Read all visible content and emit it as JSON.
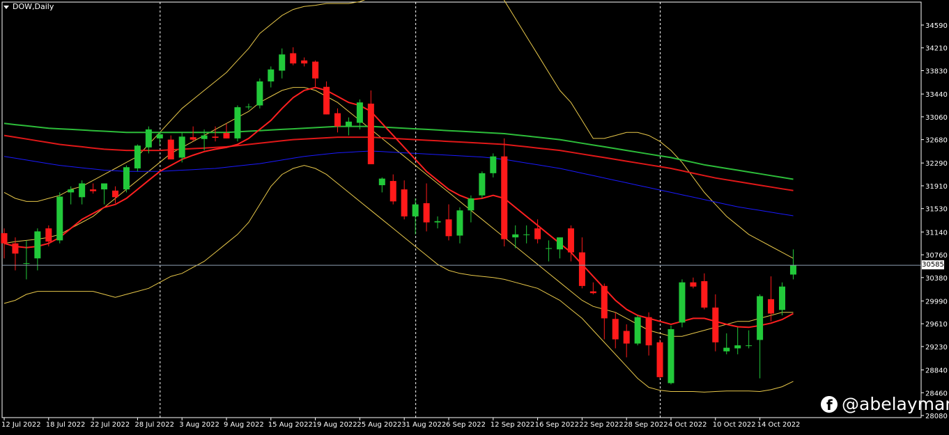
{
  "header": {
    "symbol_timeframe": "DOW,Daily"
  },
  "watermark": {
    "text": "@abelayman",
    "icon": "facebook-icon"
  },
  "current_price_label": "30585",
  "colors": {
    "background": "#000000",
    "bull": "#22c93a",
    "bear": "#ff1a1a",
    "ema_fast": "#ff2020",
    "ema_slow_red": "#e01818",
    "ema_green": "#2dbd3a",
    "ema_blue": "#1a1aff",
    "bands": "#e8c84a",
    "grid": "#ffffff",
    "axis": "#ffffff"
  },
  "chart_data": {
    "type": "candlestick",
    "title": "DOW,Daily",
    "y_ticks": [
      "34590",
      "34210",
      "33830",
      "33440",
      "33060",
      "32680",
      "32290",
      "31910",
      "31530",
      "31140",
      "30760",
      "30380",
      "29990",
      "29610",
      "29230",
      "28840",
      "28460",
      "28080"
    ],
    "y_tick_values": [
      34590,
      34210,
      33830,
      33440,
      33060,
      32680,
      32290,
      31910,
      31530,
      31140,
      30760,
      30380,
      29990,
      29610,
      29230,
      28840,
      28460,
      28080
    ],
    "x_ticks": [
      "12 Jul 2022",
      "18 Jul 2022",
      "22 Jul 2022",
      "28 Jul 2022",
      "3 Aug 2022",
      "9 Aug 2022",
      "15 Aug 2022",
      "19 Aug 2022",
      "25 Aug 2022",
      "31 Aug 2022",
      "6 Sep 2022",
      "12 Sep 2022",
      "16 Sep 2022",
      "22 Sep 2022",
      "28 Sep 2022",
      "4 Oct 2022",
      "10 Oct 2022",
      "14 Oct 2022"
    ],
    "current_price": 30585,
    "candles": [
      {
        "o": 31120,
        "h": 31200,
        "l": 30700,
        "c": 30950
      },
      {
        "o": 30950,
        "h": 31050,
        "l": 30500,
        "c": 30780
      },
      {
        "o": 30620,
        "h": 31000,
        "l": 30350,
        "c": 30620
      },
      {
        "o": 30700,
        "h": 31200,
        "l": 30500,
        "c": 31150
      },
      {
        "o": 31200,
        "h": 31250,
        "l": 30900,
        "c": 30980
      },
      {
        "o": 31000,
        "h": 31800,
        "l": 30950,
        "c": 31730
      },
      {
        "o": 31800,
        "h": 31900,
        "l": 31600,
        "c": 31850
      },
      {
        "o": 31720,
        "h": 32000,
        "l": 31600,
        "c": 31950
      },
      {
        "o": 31850,
        "h": 31950,
        "l": 31780,
        "c": 31820
      },
      {
        "o": 31850,
        "h": 31950,
        "l": 31600,
        "c": 31950
      },
      {
        "o": 31830,
        "h": 31900,
        "l": 31620,
        "c": 31720
      },
      {
        "o": 31850,
        "h": 32250,
        "l": 31800,
        "c": 32220
      },
      {
        "o": 32200,
        "h": 32600,
        "l": 32150,
        "c": 32580
      },
      {
        "o": 32550,
        "h": 32900,
        "l": 32450,
        "c": 32850
      },
      {
        "o": 32700,
        "h": 32800,
        "l": 32600,
        "c": 32770
      },
      {
        "o": 32680,
        "h": 32750,
        "l": 32350,
        "c": 32350
      },
      {
        "o": 32380,
        "h": 32800,
        "l": 32300,
        "c": 32730
      },
      {
        "o": 32720,
        "h": 32900,
        "l": 32650,
        "c": 32680
      },
      {
        "o": 32690,
        "h": 32850,
        "l": 32500,
        "c": 32750
      },
      {
        "o": 32730,
        "h": 32900,
        "l": 32650,
        "c": 32710
      },
      {
        "o": 32790,
        "h": 32950,
        "l": 32700,
        "c": 32700
      },
      {
        "o": 32700,
        "h": 33250,
        "l": 32650,
        "c": 33220
      },
      {
        "o": 33230,
        "h": 33280,
        "l": 33180,
        "c": 33230
      },
      {
        "o": 33250,
        "h": 33700,
        "l": 33200,
        "c": 33650
      },
      {
        "o": 33650,
        "h": 33900,
        "l": 33550,
        "c": 33850
      },
      {
        "o": 33830,
        "h": 34200,
        "l": 33700,
        "c": 34100
      },
      {
        "o": 34120,
        "h": 34220,
        "l": 33920,
        "c": 33950
      },
      {
        "o": 34000,
        "h": 34050,
        "l": 33900,
        "c": 33950
      },
      {
        "o": 33980,
        "h": 34000,
        "l": 33550,
        "c": 33700
      },
      {
        "o": 33560,
        "h": 33650,
        "l": 33100,
        "c": 33100
      },
      {
        "o": 33120,
        "h": 33200,
        "l": 32800,
        "c": 32900
      },
      {
        "o": 32900,
        "h": 33050,
        "l": 32750,
        "c": 32980
      },
      {
        "o": 32960,
        "h": 33350,
        "l": 32850,
        "c": 33300
      },
      {
        "o": 33280,
        "h": 33500,
        "l": 32300,
        "c": 32270
      },
      {
        "o": 31920,
        "h": 32050,
        "l": 31800,
        "c": 32030
      },
      {
        "o": 31990,
        "h": 32100,
        "l": 31600,
        "c": 31650
      },
      {
        "o": 31850,
        "h": 32000,
        "l": 31350,
        "c": 31400
      },
      {
        "o": 31400,
        "h": 31700,
        "l": 31100,
        "c": 31600
      },
      {
        "o": 31620,
        "h": 31950,
        "l": 31150,
        "c": 31300
      },
      {
        "o": 31300,
        "h": 31400,
        "l": 31200,
        "c": 31320
      },
      {
        "o": 31350,
        "h": 31600,
        "l": 31000,
        "c": 31070
      },
      {
        "o": 31080,
        "h": 31550,
        "l": 30950,
        "c": 31500
      },
      {
        "o": 31500,
        "h": 31750,
        "l": 31300,
        "c": 31700
      },
      {
        "o": 31750,
        "h": 32150,
        "l": 31700,
        "c": 32120
      },
      {
        "o": 32120,
        "h": 32450,
        "l": 32050,
        "c": 32400
      },
      {
        "o": 32400,
        "h": 32700,
        "l": 30900,
        "c": 31020
      },
      {
        "o": 31050,
        "h": 31250,
        "l": 30870,
        "c": 31100
      },
      {
        "o": 31100,
        "h": 31250,
        "l": 30950,
        "c": 31100
      },
      {
        "o": 31200,
        "h": 31350,
        "l": 30950,
        "c": 31020
      },
      {
        "o": 30870,
        "h": 31000,
        "l": 30650,
        "c": 30870
      },
      {
        "o": 30850,
        "h": 31050,
        "l": 30700,
        "c": 31050
      },
      {
        "o": 31200,
        "h": 31250,
        "l": 30650,
        "c": 30800
      },
      {
        "o": 30800,
        "h": 31050,
        "l": 30200,
        "c": 30240
      },
      {
        "o": 30150,
        "h": 30300,
        "l": 30100,
        "c": 30120
      },
      {
        "o": 30240,
        "h": 30280,
        "l": 29350,
        "c": 29700
      },
      {
        "o": 29690,
        "h": 29800,
        "l": 29200,
        "c": 29350
      },
      {
        "o": 29490,
        "h": 29600,
        "l": 29050,
        "c": 29280
      },
      {
        "o": 29280,
        "h": 29750,
        "l": 29250,
        "c": 29720
      },
      {
        "o": 29720,
        "h": 29800,
        "l": 29080,
        "c": 29250
      },
      {
        "o": 29300,
        "h": 29350,
        "l": 28700,
        "c": 28720
      },
      {
        "o": 28620,
        "h": 29580,
        "l": 28600,
        "c": 29520
      },
      {
        "o": 29630,
        "h": 30350,
        "l": 29550,
        "c": 30300
      },
      {
        "o": 30300,
        "h": 30380,
        "l": 30200,
        "c": 30230
      },
      {
        "o": 30320,
        "h": 30450,
        "l": 29850,
        "c": 29880
      },
      {
        "o": 29880,
        "h": 30100,
        "l": 29150,
        "c": 29300
      },
      {
        "o": 29150,
        "h": 29450,
        "l": 29100,
        "c": 29210
      },
      {
        "o": 29200,
        "h": 29550,
        "l": 29100,
        "c": 29250
      },
      {
        "o": 29250,
        "h": 29500,
        "l": 29200,
        "c": 29250
      },
      {
        "o": 29340,
        "h": 30100,
        "l": 28700,
        "c": 30070
      },
      {
        "o": 30020,
        "h": 30400,
        "l": 29650,
        "c": 29780
      },
      {
        "o": 29840,
        "h": 30300,
        "l": 29750,
        "c": 30230
      },
      {
        "o": 30430,
        "h": 30850,
        "l": 30350,
        "c": 30585
      }
    ],
    "ma_green": [
      32950,
      32930,
      32910,
      32890,
      32870,
      32860,
      32850,
      32840,
      32830,
      32820,
      32810,
      32800,
      32800,
      32800,
      32800,
      32800,
      32800,
      32800,
      32800,
      32800,
      32800,
      32810,
      32820,
      32830,
      32840,
      32850,
      32860,
      32870,
      32880,
      32890,
      32900,
      32900,
      32900,
      32900,
      32890,
      32880,
      32870,
      32860,
      32850,
      32840,
      32830,
      32820,
      32810,
      32800,
      32790,
      32780,
      32760,
      32740,
      32720,
      32700,
      32680,
      32650,
      32620,
      32590,
      32560,
      32530,
      32500,
      32470,
      32440,
      32410,
      32380,
      32340,
      32300,
      32260,
      32230,
      32200,
      32170,
      32140,
      32110,
      32080,
      32050,
      32020
    ],
    "ma_red_slow": [
      32750,
      32720,
      32690,
      32660,
      32630,
      32600,
      32580,
      32560,
      32540,
      32520,
      32510,
      32500,
      32500,
      32500,
      32500,
      32510,
      32520,
      32530,
      32540,
      32550,
      32560,
      32580,
      32600,
      32620,
      32640,
      32660,
      32680,
      32690,
      32700,
      32710,
      32720,
      32720,
      32720,
      32720,
      32710,
      32700,
      32690,
      32680,
      32670,
      32660,
      32650,
      32640,
      32630,
      32620,
      32610,
      32600,
      32580,
      32560,
      32540,
      32520,
      32500,
      32470,
      32440,
      32410,
      32380,
      32350,
      32320,
      32290,
      32260,
      32230,
      32200,
      32160,
      32120,
      32080,
      32040,
      32010,
      31980,
      31950,
      31920,
      31890,
      31860,
      31830
    ],
    "ma_blue": [
      32400,
      32370,
      32340,
      32310,
      32280,
      32250,
      32230,
      32210,
      32190,
      32170,
      32160,
      32150,
      32150,
      32150,
      32150,
      32160,
      32170,
      32180,
      32190,
      32200,
      32220,
      32240,
      32260,
      32280,
      32310,
      32340,
      32370,
      32400,
      32420,
      32440,
      32460,
      32470,
      32480,
      32490,
      32480,
      32470,
      32460,
      32450,
      32440,
      32430,
      32420,
      32410,
      32400,
      32390,
      32370,
      32350,
      32320,
      32290,
      32260,
      32230,
      32200,
      32160,
      32120,
      32080,
      32040,
      32000,
      31960,
      31920,
      31880,
      31840,
      31800,
      31760,
      31720,
      31680,
      31640,
      31600,
      31560,
      31530,
      31500,
      31470,
      31440,
      31410
    ],
    "ma_fast": [
      30950,
      30900,
      30880,
      30900,
      30950,
      31050,
      31200,
      31350,
      31450,
      31550,
      31600,
      31700,
      31850,
      32000,
      32150,
      32250,
      32350,
      32420,
      32480,
      32520,
      32550,
      32600,
      32700,
      32850,
      33000,
      33200,
      33380,
      33500,
      33550,
      33500,
      33400,
      33300,
      33250,
      33150,
      32950,
      32750,
      32550,
      32350,
      32150,
      32000,
      31850,
      31750,
      31680,
      31700,
      31750,
      31700,
      31550,
      31400,
      31250,
      31100,
      30950,
      30800,
      30600,
      30400,
      30200,
      30000,
      29850,
      29750,
      29700,
      29650,
      29600,
      29650,
      29700,
      29700,
      29650,
      29600,
      29560,
      29550,
      29580,
      29620,
      29680,
      29780
    ],
    "band_upper": [
      31800,
      31700,
      31650,
      31650,
      31700,
      31750,
      31850,
      31900,
      32000,
      32100,
      32200,
      32300,
      32400,
      32600,
      32800,
      33000,
      33200,
      33350,
      33500,
      33650,
      33800,
      34000,
      34200,
      34450,
      34600,
      34750,
      34850,
      34900,
      34920,
      34950,
      34950,
      34950,
      34980,
      35050,
      35150,
      35250,
      35350,
      35450,
      35550,
      35600,
      35650,
      35650,
      35600,
      35500,
      35300,
      35000,
      34700,
      34400,
      34100,
      33800,
      33500,
      33300,
      33000,
      32700,
      32700,
      32750,
      32800,
      32800,
      32750,
      32650,
      32500,
      32300,
      32050,
      31800,
      31600,
      31400,
      31250,
      31100,
      31000,
      30900,
      30800,
      30700
    ],
    "band_mid": [
      30950,
      30980,
      31000,
      31020,
      31050,
      31100,
      31200,
      31300,
      31400,
      31550,
      31700,
      31850,
      32000,
      32150,
      32300,
      32450,
      32550,
      32650,
      32750,
      32850,
      32950,
      33050,
      33150,
      33300,
      33400,
      33500,
      33550,
      33550,
      33500,
      33400,
      33300,
      33150,
      33000,
      32850,
      32700,
      32550,
      32400,
      32250,
      32100,
      31950,
      31800,
      31650,
      31500,
      31350,
      31200,
      31050,
      30900,
      30750,
      30600,
      30450,
      30300,
      30150,
      30000,
      29900,
      29850,
      29800,
      29700,
      29600,
      29500,
      29450,
      29400,
      29400,
      29450,
      29500,
      29550,
      29600,
      29650,
      29650,
      29700,
      29750,
      29800,
      29800
    ],
    "band_lower": [
      29950,
      30000,
      30100,
      30150,
      30150,
      30150,
      30150,
      30150,
      30150,
      30100,
      30050,
      30100,
      30150,
      30200,
      30300,
      30400,
      30450,
      30550,
      30650,
      30800,
      30950,
      31100,
      31300,
      31600,
      31900,
      32100,
      32200,
      32250,
      32200,
      32100,
      31950,
      31800,
      31650,
      31500,
      31350,
      31200,
      31050,
      30900,
      30750,
      30600,
      30500,
      30450,
      30420,
      30400,
      30380,
      30350,
      30300,
      30250,
      30200,
      30100,
      30000,
      29850,
      29700,
      29500,
      29300,
      29100,
      28900,
      28700,
      28550,
      28500,
      28480,
      28480,
      28480,
      28470,
      28480,
      28490,
      28490,
      28490,
      28480,
      28510,
      28560,
      28650
    ]
  }
}
